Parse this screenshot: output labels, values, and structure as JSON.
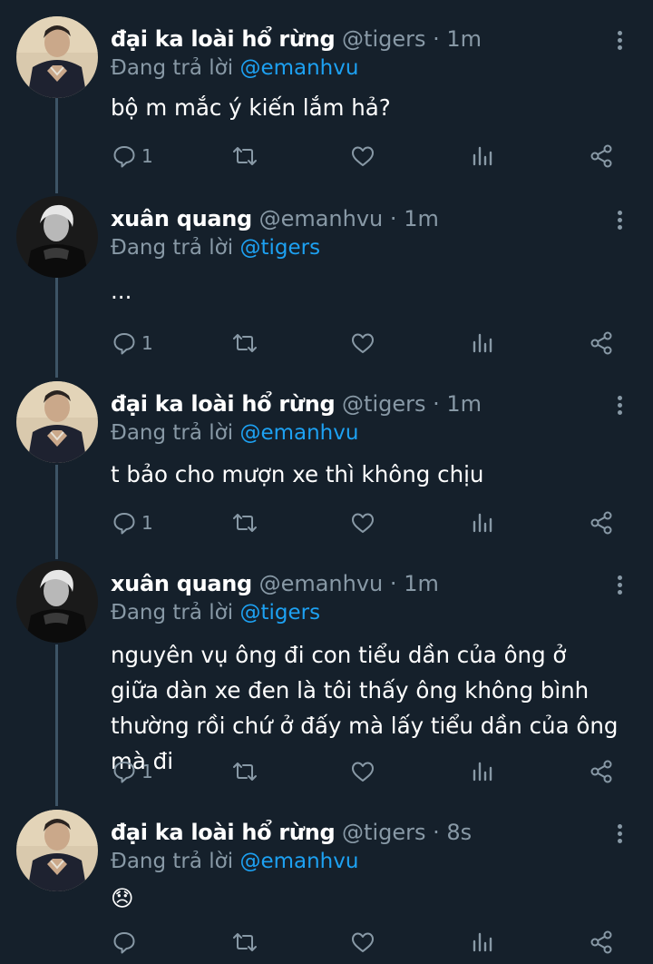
{
  "reply_prefix": "Đang trả lời",
  "header_separator": "·",
  "icons": {
    "reply": "reply-icon",
    "retweet": "retweet-icon",
    "like": "like-icon",
    "analytics": "analytics-icon",
    "share": "share-icon",
    "more": "more-vertical-icon"
  },
  "colors": {
    "background": "#15202b",
    "muted": "#8899a6",
    "link": "#1da1f2",
    "thread_line": "#3d5466"
  },
  "tweets": [
    {
      "name": "đại ka loài hổ rừng",
      "handle": "@tigers",
      "time": "1m",
      "reply_to": "@emanhvu",
      "text": "bộ m mắc ý kiến lắm hả?",
      "reply_count": "1"
    },
    {
      "name": "xuân quang",
      "handle": "@emanhvu",
      "time": "1m",
      "reply_to": "@tigers",
      "text": "...",
      "reply_count": "1"
    },
    {
      "name": "đại ka loài hổ rừng",
      "handle": "@tigers",
      "time": "1m",
      "reply_to": "@emanhvu",
      "text": "t bảo cho mượn xe thì không chịu",
      "reply_count": "1"
    },
    {
      "name": "xuân quang",
      "handle": "@emanhvu",
      "time": "1m",
      "reply_to": "@tigers",
      "text": "nguyên vụ ông đi con tiểu dần của ông ở giữa dàn xe đen là tôi thấy ông không bình thường rồi chứ ở đấy mà lấy tiểu dần của ông mà đi",
      "reply_count": "1"
    },
    {
      "name": "đại ka loài hổ rừng",
      "handle": "@tigers",
      "time": "8s",
      "reply_to": "@emanhvu",
      "text": "😞",
      "reply_count": ""
    }
  ]
}
